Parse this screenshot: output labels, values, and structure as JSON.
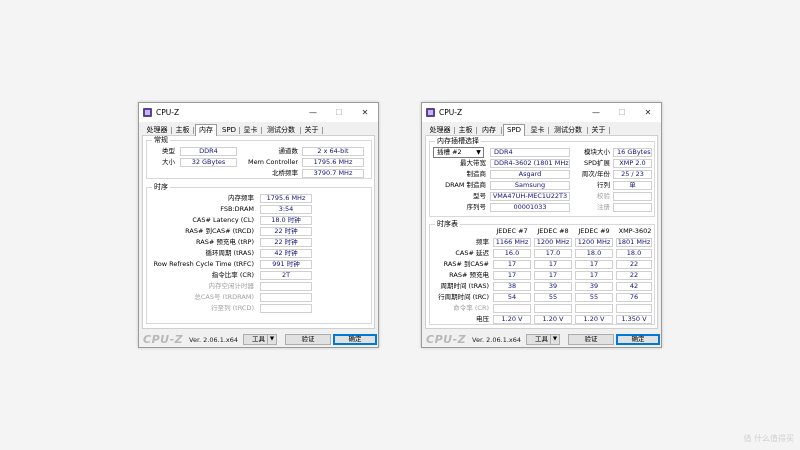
{
  "left": {
    "title": "CPU-Z",
    "tabs": [
      "处理器",
      "主板",
      "内存",
      "SPD",
      "显卡",
      "测试分数",
      "关于"
    ],
    "general": {
      "title": "常规",
      "type_label": "类型",
      "type_value": "DDR4",
      "size_label": "大小",
      "size_value": "32 GBytes",
      "channels_label": "通道数",
      "channels_value": "2 x 64-bit",
      "mc_label": "Mem Controller",
      "mc_value": "1795.6 MHz",
      "nb_label": "北桥频率",
      "nb_value": "3790.7 MHz"
    },
    "timings": {
      "title": "时序",
      "rows": [
        {
          "label": "内存频率",
          "value": "1795.6 MHz",
          "disabled": false
        },
        {
          "label": "FSB:DRAM",
          "value": "3:54",
          "disabled": false
        },
        {
          "label": "CAS# Latency (CL)",
          "value": "18.0 时钟",
          "disabled": false
        },
        {
          "label": "RAS# 到CAS# (tRCD)",
          "value": "22 时钟",
          "disabled": false
        },
        {
          "label": "RAS# 预充电 (tRP)",
          "value": "22 时钟",
          "disabled": false
        },
        {
          "label": "循环周期 (tRAS)",
          "value": "42 时钟",
          "disabled": false
        },
        {
          "label": "Row Refresh Cycle Time (tRFC)",
          "value": "991 时钟",
          "disabled": false
        },
        {
          "label": "指令比率 (CR)",
          "value": "2T",
          "disabled": false
        },
        {
          "label": "内存空闲计时器",
          "value": "",
          "disabled": true
        },
        {
          "label": "总CAS号 (tRDRAM)",
          "value": "",
          "disabled": true
        },
        {
          "label": "行至列 (tRCD)",
          "value": "",
          "disabled": true
        }
      ]
    },
    "footer": {
      "brand": "CPU-Z",
      "version": "Ver. 2.06.1.x64",
      "tools": "工具",
      "validate": "验证",
      "ok": "确定"
    }
  },
  "right": {
    "title": "CPU-Z",
    "tabs": [
      "处理器",
      "主板",
      "内存",
      "SPD",
      "显卡",
      "测试分数",
      "关于"
    ],
    "slot": {
      "title": "内存插槽选择",
      "selected": "插槽 #2",
      "type_value": "DDR4",
      "module_size_label": "模块大小",
      "module_size_value": "16 GBytes",
      "max_bw_label": "最大带宽",
      "max_bw_value": "DDR4-3602 (1801 MHz)",
      "spd_ext_label": "SPD扩展",
      "spd_ext_value": "XMP 2.0",
      "manufacturer_label": "制造商",
      "manufacturer_value": "Asgard",
      "week_year_label": "周次/年份",
      "week_year_value": "25 / 23",
      "dram_mfr_label": "DRAM 制造商",
      "dram_mfr_value": "Samsung",
      "ranks_label": "行列",
      "ranks_value": "单",
      "part_label": "型号",
      "part_value": "VMA47UH-MEC1U22T3",
      "correction_label": "校验",
      "correction_value": "",
      "serial_label": "序列号",
      "serial_value": "00001033",
      "registered_label": "注册",
      "registered_value": ""
    },
    "timings_table": {
      "title": "时序表",
      "columns": [
        "JEDEC #7",
        "JEDEC #8",
        "JEDEC #9",
        "XMP-3602"
      ],
      "rows": [
        {
          "label": "频率",
          "values": [
            "1166 MHz",
            "1200 MHz",
            "1200 MHz",
            "1801 MHz"
          ],
          "disabled": false
        },
        {
          "label": "CAS# 延迟",
          "values": [
            "16.0",
            "17.0",
            "18.0",
            "18.0"
          ],
          "disabled": false
        },
        {
          "label": "RAS# 到CAS#",
          "values": [
            "17",
            "17",
            "17",
            "22"
          ],
          "disabled": false
        },
        {
          "label": "RAS# 预充电",
          "values": [
            "17",
            "17",
            "17",
            "22"
          ],
          "disabled": false
        },
        {
          "label": "周期时间 (tRAS)",
          "values": [
            "38",
            "39",
            "39",
            "42"
          ],
          "disabled": false
        },
        {
          "label": "行周期时间 (tRC)",
          "values": [
            "54",
            "55",
            "55",
            "76"
          ],
          "disabled": false
        },
        {
          "label": "命令率 (CR)",
          "values": [
            "",
            "",
            "",
            ""
          ],
          "disabled": true
        },
        {
          "label": "电压",
          "values": [
            "1.20 V",
            "1.20 V",
            "1.20 V",
            "1.350 V"
          ],
          "disabled": false
        }
      ]
    },
    "footer": {
      "brand": "CPU-Z",
      "version": "Ver. 2.06.1.x64",
      "tools": "工具",
      "validate": "验证",
      "ok": "确定"
    }
  },
  "watermark": "值 什么值得买"
}
